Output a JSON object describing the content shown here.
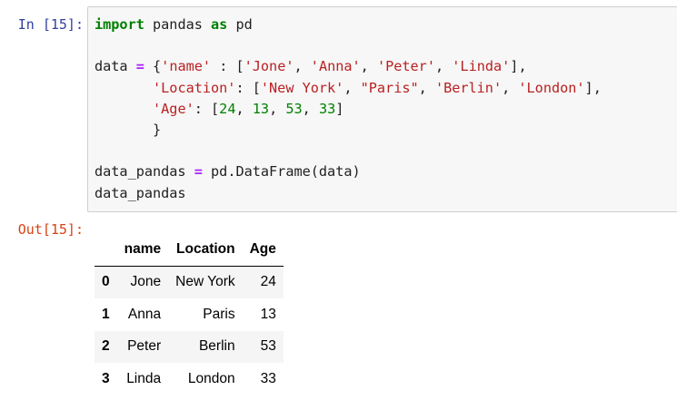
{
  "input_prompt": "In [15]:",
  "output_prompt": "Out[15]:",
  "code": {
    "l1": {
      "kw_import": "import",
      "mod": " pandas ",
      "kw_as": "as",
      "alias": " pd"
    },
    "l3": {
      "var": "data ",
      "eq": "=",
      "p1": " {",
      "k1": "'name'",
      "p2": " : [",
      "s1": "'Jone'",
      "c1": ", ",
      "s2": "'Anna'",
      "c2": ", ",
      "s3": "'Peter'",
      "c3": ", ",
      "s4": "'Linda'",
      "p3": "],"
    },
    "l4": {
      "indent": "       ",
      "k2": "'Location'",
      "p1": ": [",
      "s1": "'New York'",
      "c1": ", ",
      "s2": "\"Paris\"",
      "c2": ", ",
      "s3": "'Berlin'",
      "c3": ", ",
      "s4": "'London'",
      "p2": "],"
    },
    "l5": {
      "indent": "       ",
      "k3": "'Age'",
      "p1": ": [",
      "n1": "24",
      "c1": ", ",
      "n2": "13",
      "c2": ", ",
      "n3": "53",
      "c3": ", ",
      "n4": "33",
      "p2": "]"
    },
    "l6": {
      "text": "       }"
    },
    "l8": {
      "var": "data_pandas ",
      "eq": "=",
      "rest": " pd.DataFrame(data)"
    },
    "l9": {
      "text": "data_pandas"
    }
  },
  "table": {
    "columns": [
      "name",
      "Location",
      "Age"
    ],
    "rows": [
      {
        "index": "0",
        "cells": [
          "Jone",
          "New York",
          "24"
        ]
      },
      {
        "index": "1",
        "cells": [
          "Anna",
          "Paris",
          "13"
        ]
      },
      {
        "index": "2",
        "cells": [
          "Peter",
          "Berlin",
          "53"
        ]
      },
      {
        "index": "3",
        "cells": [
          "Linda",
          "London",
          "33"
        ]
      }
    ]
  }
}
